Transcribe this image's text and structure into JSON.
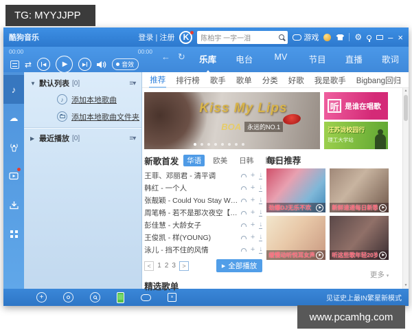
{
  "overlay": {
    "tg": "TG: MYYJJPP",
    "watermark": "www.pcamhg.com"
  },
  "titlebar": {
    "app": "酷狗音乐",
    "login_register": "登录 | 注册",
    "logo_letter": "K",
    "search_value": "陈柏宇 一字一泪",
    "game": "游戏"
  },
  "player": {
    "elapsed": "00:00",
    "total": "00:00",
    "effect": "音效"
  },
  "nav": {
    "tabs": [
      "乐库",
      "电台",
      "MV",
      "节目",
      "直播",
      "歌词"
    ]
  },
  "subnav": {
    "items": [
      "推荐",
      "排行榜",
      "歌手",
      "歌单",
      "分类",
      "好歌",
      "我是歌手",
      "Bigbang回归"
    ]
  },
  "sidebar": {
    "default_list": "默认列表",
    "default_count": "[0]",
    "add_song": "添加本地歌曲",
    "add_folder": "添加本地歌曲文件夹",
    "recent": "最近播放",
    "recent_count": "[0]"
  },
  "banner": {
    "title": "Kiss My Lips",
    "artist": "BOA",
    "tagline": "永远的NO.1"
  },
  "side_banners": {
    "top_big": "听",
    "top_text": "是谁在唱歌",
    "bottom_line1": "汪苏泷校园行",
    "bottom_line2": "理工大学站"
  },
  "new_songs": {
    "heading": "新歌首发",
    "tabs": [
      "华语",
      "欧美",
      "日韩",
      "影视"
    ],
    "songs": [
      "王菲、邓丽君 - 清平调",
      "韩红 - 一个人",
      "张靓颖 - Could You Stay With Me 【…",
      "周笔畅 - 若不是那次夜空【重生爱人…",
      "彭佳慧 - 大龄女子",
      "王俊凯 - 样(YOUNG)",
      "泳儿 - 挡不住的风情"
    ],
    "pages": [
      "1",
      "2",
      "3"
    ],
    "play_all": "全部播放"
  },
  "daily": {
    "heading": "每日推荐",
    "cards": [
      "劲爆DJ无乐不欢",
      "新鲜速递每日新歌",
      "缓慢动听悦耳女声",
      "听这些歌年轻20岁"
    ]
  },
  "featured": {
    "heading": "精选歌单",
    "more": "更多"
  },
  "bottombar": {
    "promo": "见证史上最IN繁星新模式"
  },
  "icons": {
    "back": "←",
    "refresh": "↻",
    "gear": "⚙",
    "minimize": "–",
    "close": "×",
    "caret_down": "▼",
    "caret_right": "▶",
    "menu": "≡▾",
    "note": "♪",
    "repeat": "⇄",
    "cloud": "☁",
    "plus": "+",
    "download": "↓",
    "play": "▶",
    "prev": "◀",
    "up": "▲",
    "down": "▼",
    "pg_prev": "<",
    "pg_next": ">",
    "more_caret": "▾"
  },
  "colors": {
    "accent_blue": "#3f89da",
    "link_blue": "#2f82dd",
    "badge_red": "#e63c2e",
    "phone_green": "#55c14a"
  }
}
